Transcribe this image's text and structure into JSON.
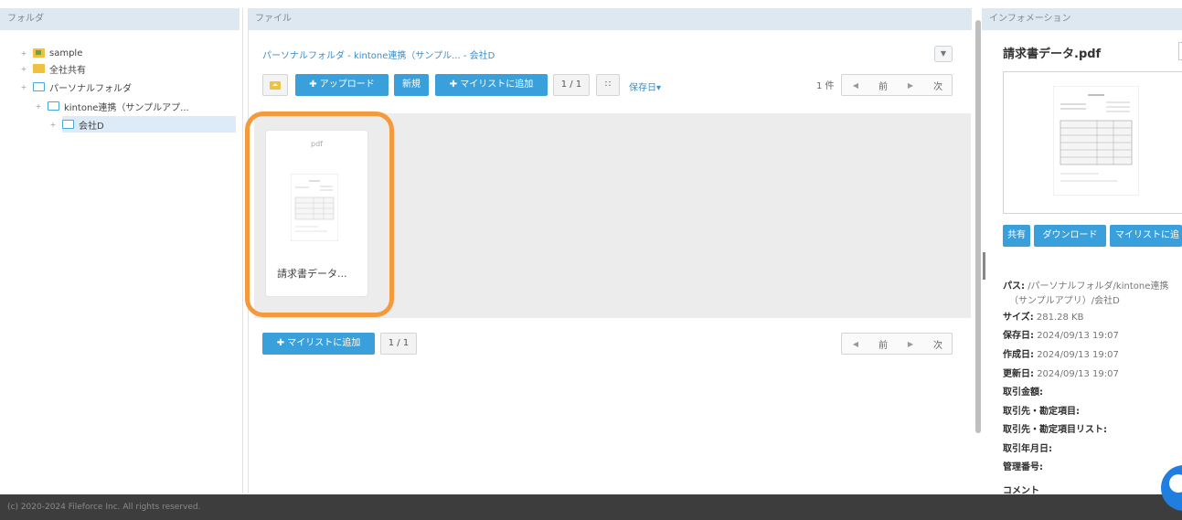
{
  "headers": {
    "folder": "フォルダ",
    "file": "ファイル",
    "info": "インフォメーション"
  },
  "tree": {
    "items": [
      {
        "label": "sample",
        "icon": "sample-folder-icon"
      },
      {
        "label": "全社共有",
        "icon": "folder-icon"
      },
      {
        "label": "パーソナルフォルダ",
        "icon": "folder-icon"
      },
      {
        "label": "kintone連携（サンプルアプ...",
        "icon": "folder-icon"
      },
      {
        "label": "会社D",
        "icon": "folder-icon"
      }
    ]
  },
  "file_panel": {
    "breadcrumb": "パーソナルフォルダ - kintone連携（サンプル... - 会社D",
    "toolbar": {
      "upload": "アップロード",
      "new": "新規",
      "add_mylist": "マイリストに追加",
      "page": "1 / 1",
      "sort": "保存日"
    },
    "count": "1 件",
    "prev": "前",
    "next": "次",
    "files": [
      {
        "ext": "pdf",
        "name": "請求書データ..."
      }
    ],
    "bottom": {
      "add_mylist": "マイリストに追加",
      "page": "1 / 1",
      "prev": "前",
      "next": "次"
    }
  },
  "info": {
    "title": "請求書データ.pdf",
    "buttons": {
      "share": "共有",
      "download": "ダウンロード",
      "add_mylist": "マイリストに追"
    },
    "path_label": "パス:",
    "path_value": "/パーソナルフォルダ/kintone連携",
    "path_value2": "（サンプルアプリ）/会社D",
    "size_label": "サイズ:",
    "size_value": "281.28 KB",
    "saved_label": "保存日:",
    "saved_value": "2024/09/13 19:07",
    "created_label": "作成日:",
    "created_value": "2024/09/13 19:07",
    "updated_label": "更新日:",
    "updated_value": "2024/09/13 19:07",
    "amount_label": "取引金額:",
    "partner_label": "取引先・勘定項目:",
    "partner_list_label": "取引先・勘定項目リスト:",
    "date_label": "取引年月日:",
    "number_label": "管理番号:",
    "comment_label": "コメント"
  },
  "footer": "(c) 2020-2024 Fileforce Inc. All rights reserved.",
  "colors": {
    "accent": "#3aa0dc",
    "highlight": "#f59a3c",
    "footer": "#3d3d3d"
  }
}
